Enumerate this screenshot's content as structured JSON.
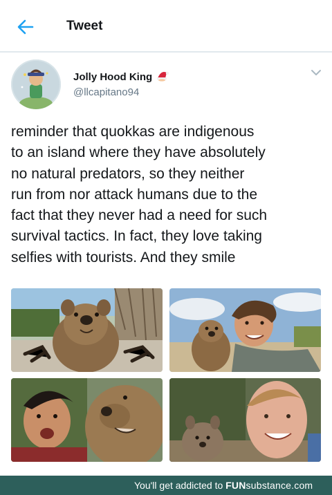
{
  "header": {
    "title": "Tweet"
  },
  "tweet": {
    "display_name": "Jolly Hood King",
    "name_emoji": "santa-hat-emoji",
    "handle": "@llcapitano94",
    "text": "reminder that quokkas are indigenous\nto an island where they have absolutely\nno natural predators, so they neither\nrun from nor attack humans due to the\nfact that they never had a need for such\nsurvival tactics. In fact, they love taking\nselfies with tourists. And they smile",
    "photos": [
      "quokka-closeup-photo",
      "quokka-selfie-beach-photo",
      "quokka-selfie-surprised-man-photo",
      "quokka-selfie-smiling-man-photo"
    ]
  },
  "footer": {
    "tagline": "You'll get addicted to ",
    "brand_bold": "FUN",
    "brand_rest": "substance",
    "brand_tld": ".com"
  },
  "colors": {
    "accent": "#1da1f2",
    "secondary_text": "#657786",
    "divider": "#e1e8ed",
    "footer_bg": "#2d5f5b"
  }
}
